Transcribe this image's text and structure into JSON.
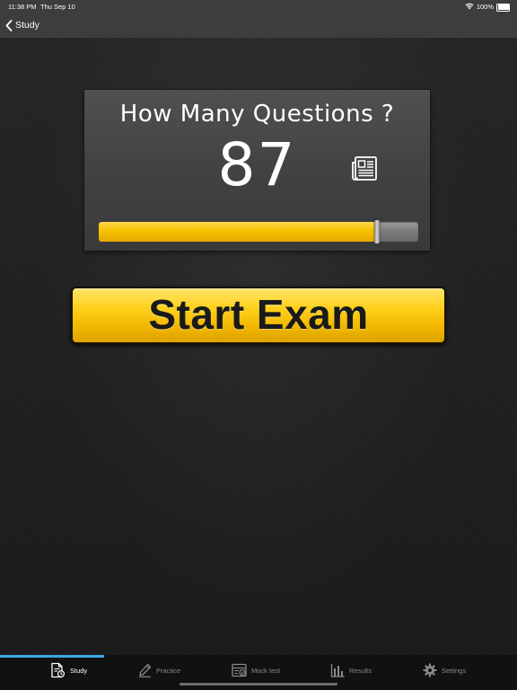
{
  "status_bar": {
    "time": "11:38 PM",
    "date": "Thu Sep 10",
    "battery": "100%",
    "wifi_icon": "wifi-icon",
    "battery_icon": "battery-icon"
  },
  "nav": {
    "back_label": "Study",
    "back_icon": "chevron-left-icon"
  },
  "panel": {
    "title": "How Many Questions ?",
    "count": "87",
    "icon": "newspaper-icon",
    "slider": {
      "value": 87,
      "max": 100
    }
  },
  "start_button": {
    "label": "Start Exam"
  },
  "tabbar": {
    "tabs": [
      {
        "label": "Study",
        "icon": "study-document-icon",
        "active": true
      },
      {
        "label": "Practice",
        "icon": "pencil-icon",
        "active": false
      },
      {
        "label": "Mock test",
        "icon": "mock-test-icon",
        "active": false
      },
      {
        "label": "Results",
        "icon": "bar-chart-icon",
        "active": false
      },
      {
        "label": "Settings",
        "icon": "gear-icon",
        "active": false
      }
    ]
  },
  "colors": {
    "accent_yellow": "#f7c200",
    "tab_indicator": "#3aa8e6",
    "panel_bg": "#454545",
    "background": "#222222"
  }
}
